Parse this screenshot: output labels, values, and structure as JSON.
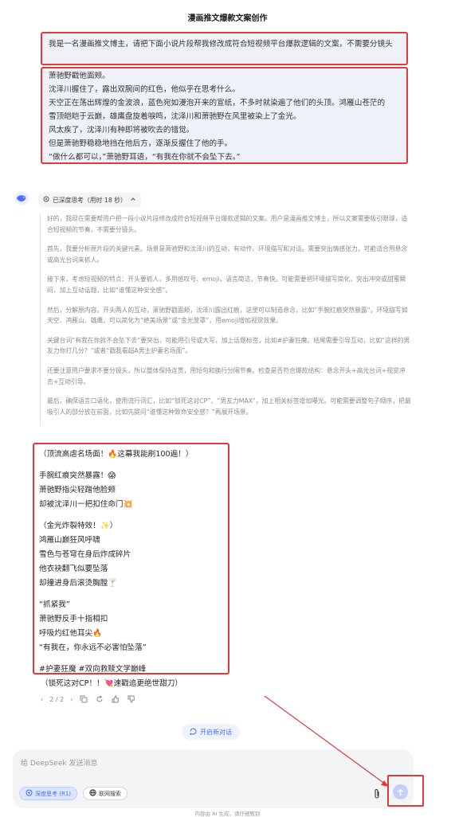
{
  "page_title": "漫画推文爆款文案创作",
  "user_prompt": "我是一名漫画推文博主，请把下面小说片段帮我修改成符合短视频平台爆款逻辑的文案，不需要分镜头",
  "story_lines": [
    "萧驰野戳他面颊。",
    "沈泽川握住了，露出双腕间的红色，他似乎在思考什么。",
    "天空正在荡出辉煌的金波浪，蓝色宛如漫泡开来的宣纸，不多时就染遍了他们的头顶。鸿雁山苍茫的",
    "雪顶皑皑于云巅，雄鹰盘旋着唳鸣，沈泽川和萧驰野在风里被染上了金光。",
    "风太疾了，沈泽川有种即将被吹去的错觉。",
    "但是萧驰野稳稳地挡在他后方，逐渐反握住了他的手。",
    "“做什么都可以，”萧驰野耳语，“有我在你就不会坠下去。”"
  ],
  "thinking": {
    "label": "已深度思考（用时 18 秒）",
    "paragraphs": [
      "好的，我现在需要帮用户把一段小说片段修改成符合短视频平台爆款逻辑的文案。用户是漫画推文博主，所以文案需要吸引眼球，适合短视频的节奏，不需要分镜头。",
      "首先，我要分析原片段的关键元素。场景是萧驰野和沈泽川的互动，有动作、环境描写和对话。需要突出情感张力，可能适合用悬念或高光台词来抓人。",
      "接下来，考虑短视频的特点：开头要抓人，多用感叹号、emoji，语言简洁，节奏快。可能需要把环境描写简化，突出冲突或甜蜜瞬间，加上互动话题，比如“谁懂这种安全感”。",
      "然后，分解原内容。开头两人的互动，萧驰野戳面颊，沈泽川露出红痕，这里可以制造悬念，比如“手腕红痕突然暴露”。环境描写如天空、鸿雁山、雄鹰，可以简化为“绝美场景”或“金光笼罩”，用emoji增加视觉效果。",
      "关键台词“有我在你就不会坠下去”要突出，可能用引号或大写，加上话题标签，比如#护妻狂魔。结尾需要引导互动，比如“这样的男友力你打几分？”或者“戳我看超A男主护妻名场面”。",
      "还要注意用户要求不要分镜头，所以整体保持连贯，用短句和换行分隔节奏。检查是否符合爆款结构：悬念开头+高光台词+视觉冲击+互动引导。",
      "最后，确保语言口语化，使用流行词汇，比如“锁死这对CP”、“男友力MAX”，加上相关标签增加曝光。可能需要调整句子顺序，把最吸引人的部分放在前面，比如先提问“谁懂这种致命安全感？”再展开场景。"
    ]
  },
  "answer_groups": [
    [
      "（顶流高虐名场面！🔥这幕我能刷100遍！）"
    ],
    [
      "手腕红痕突然暴露！😱",
      "萧驰野指尖轻蹭他脸颊",
      "却被沈泽川一把扣住命门💥"
    ],
    [
      "（金光炸裂特效！✨）",
      "鸿雁山巅狂风呼啸",
      "雪色与苍穹在身后炸成碎片",
      "他衣袂翻飞似要坠落",
      "却撞进身后滚烫胸膛🍸"
    ],
    [
      "“抓紧我”",
      "萧驰野反手十指相扣",
      "呼吸灼红他耳尖🔥",
      "“有我在，你永远不必害怕坠落”"
    ],
    [
      "#护妻狂魔 #双向救赎文学巅峰"
    ]
  ],
  "answer_tail": "（锁死这对CP！！💘速戳追更绝世甜刀）",
  "pager": "2 / 2",
  "new_chat_label": "开启新对话",
  "input_placeholder": "给 DeepSeek 发送消息",
  "deep_think_label": "深度思考 (R1)",
  "web_search_label": "联网搜索",
  "footer_text": "内容由 AI 生成，请仔细甄别",
  "colors": {
    "accent": "#4d6bfe",
    "highlight_border": "#e23a3a",
    "bubble_bg": "#eef1f7"
  }
}
